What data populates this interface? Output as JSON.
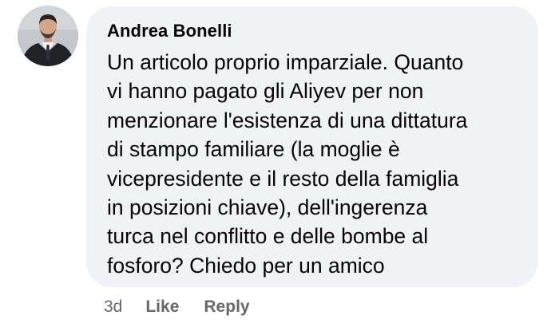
{
  "comment": {
    "author": "Andrea Bonelli",
    "text_lines": [
      "Un articolo proprio imparziale. Quanto",
      "vi hanno pagato gli Aliyev per non",
      "menzionare l'esistenza di una dittatura",
      "di stampo familiare (la moglie è",
      "vicepresidente e il resto della famiglia",
      "in posizioni chiave), dell'ingerenza",
      "turca nel conflitto e delle bombe al",
      "fosforo? Chiedo per un amico"
    ],
    "timestamp": "3d",
    "like_label": "Like",
    "reply_label": "Reply"
  },
  "colors": {
    "bubble_background": "#f0f2f5",
    "text": "#050505",
    "secondary_text": "#65676b"
  }
}
